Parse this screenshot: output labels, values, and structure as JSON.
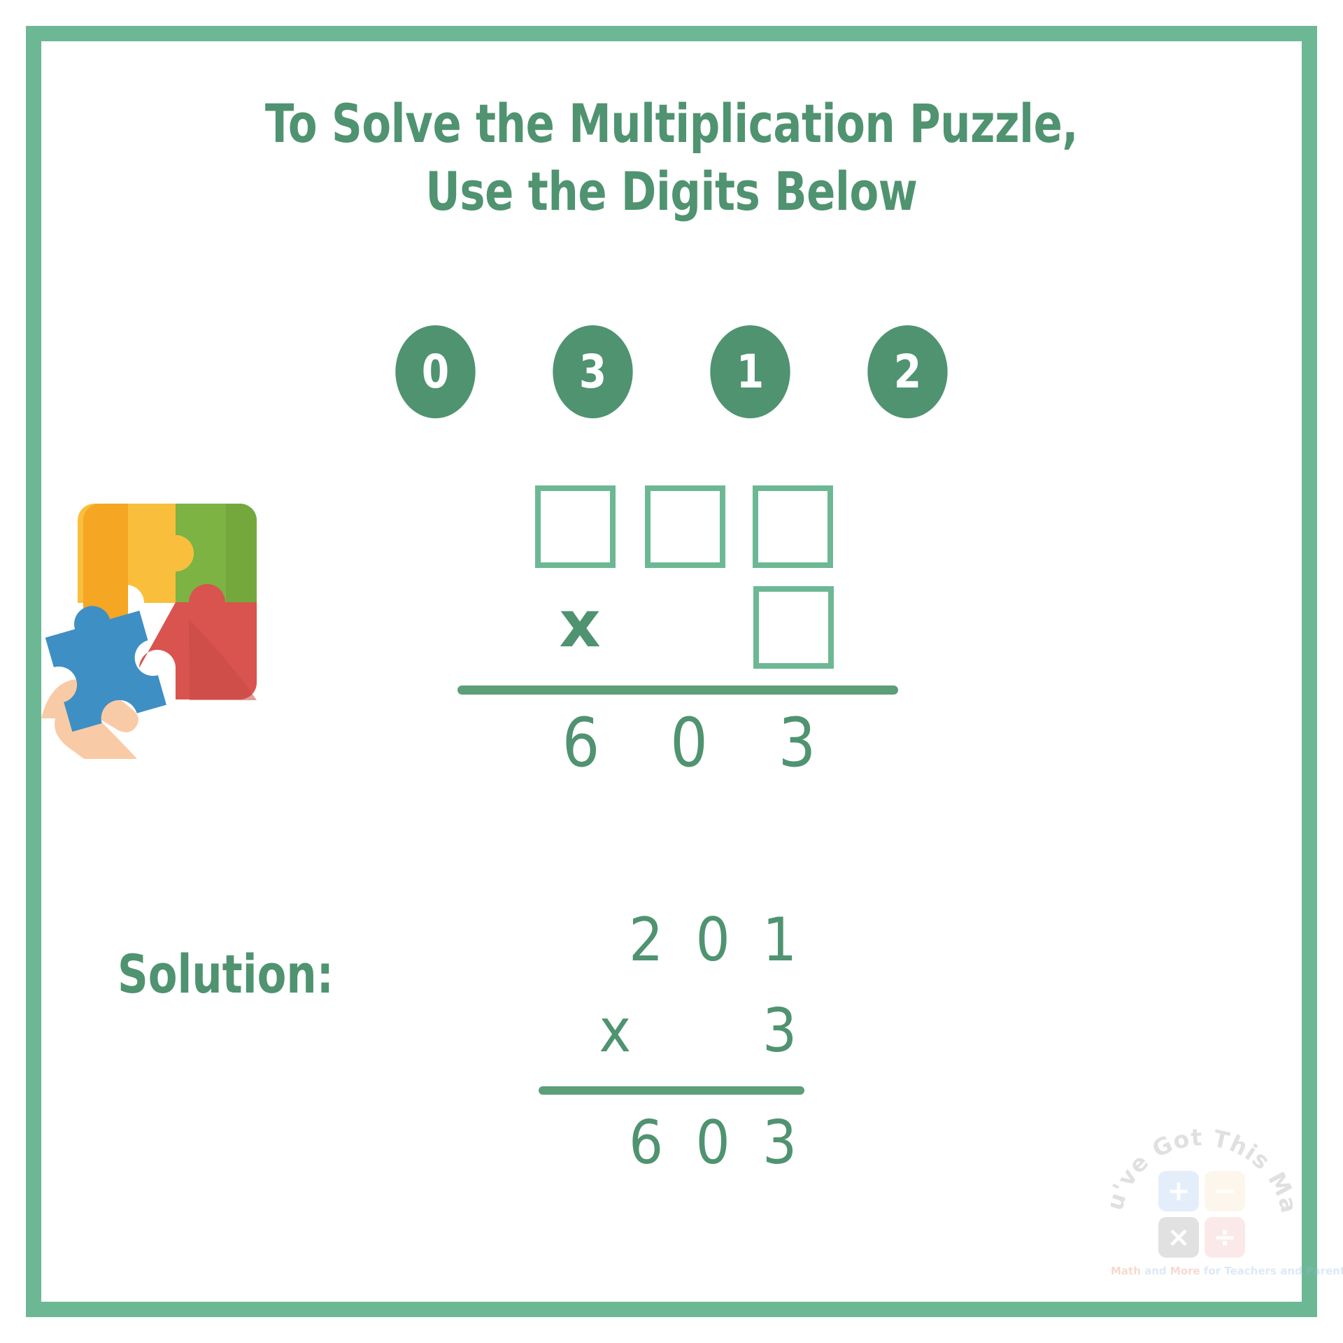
{
  "colors": {
    "frame_green": "#6DB894",
    "text_green": "#4F9370",
    "rule_green": "#5B9E78",
    "box_border_green": "#6DB894",
    "puzzle_orange": "#F5A623",
    "puzzle_yellow": "#F9BE3C",
    "puzzle_green": "#7CB342",
    "puzzle_red": "#D9534F",
    "puzzle_blue": "#3E8FC4",
    "hand_skin": "#F8CBA6"
  },
  "title": {
    "line1": "To Solve the Multiplication Puzzle,",
    "line2": "Use the Digits Below"
  },
  "digit_bank": {
    "digits": [
      "0",
      "3",
      "1",
      "2"
    ]
  },
  "puzzle_problem": {
    "multiplicand_boxes": [
      "",
      "",
      ""
    ],
    "multiplier_boxes": [
      ""
    ],
    "operator": "x",
    "product": "6 0 3",
    "product_digits": [
      "6",
      "0",
      "3"
    ]
  },
  "solution": {
    "label": "Solution:",
    "multiplicand": "201",
    "operator": "x",
    "multiplier": "3",
    "product": "603",
    "line_multiplicand": "2 0 1",
    "line_multiplier": "x     3",
    "line_product": "6 0 3"
  },
  "illustration": {
    "name": "jigsaw-puzzle-with-hand",
    "pieces": [
      "orange",
      "green",
      "red",
      "blue"
    ]
  },
  "logo": {
    "arc_text": "You've Got This Math",
    "tiles": [
      "+",
      "−",
      "×",
      "÷"
    ],
    "tagline_parts": [
      {
        "text": "Math",
        "color": "#E8836B"
      },
      {
        "text": " and ",
        "color": "#8FB7E8"
      },
      {
        "text": "More",
        "color": "#E8836B"
      },
      {
        "text": " for Teachers and Parents",
        "color": "#8FB7E8"
      }
    ],
    "tagline_full": "Math and More for Teachers and Parents"
  }
}
